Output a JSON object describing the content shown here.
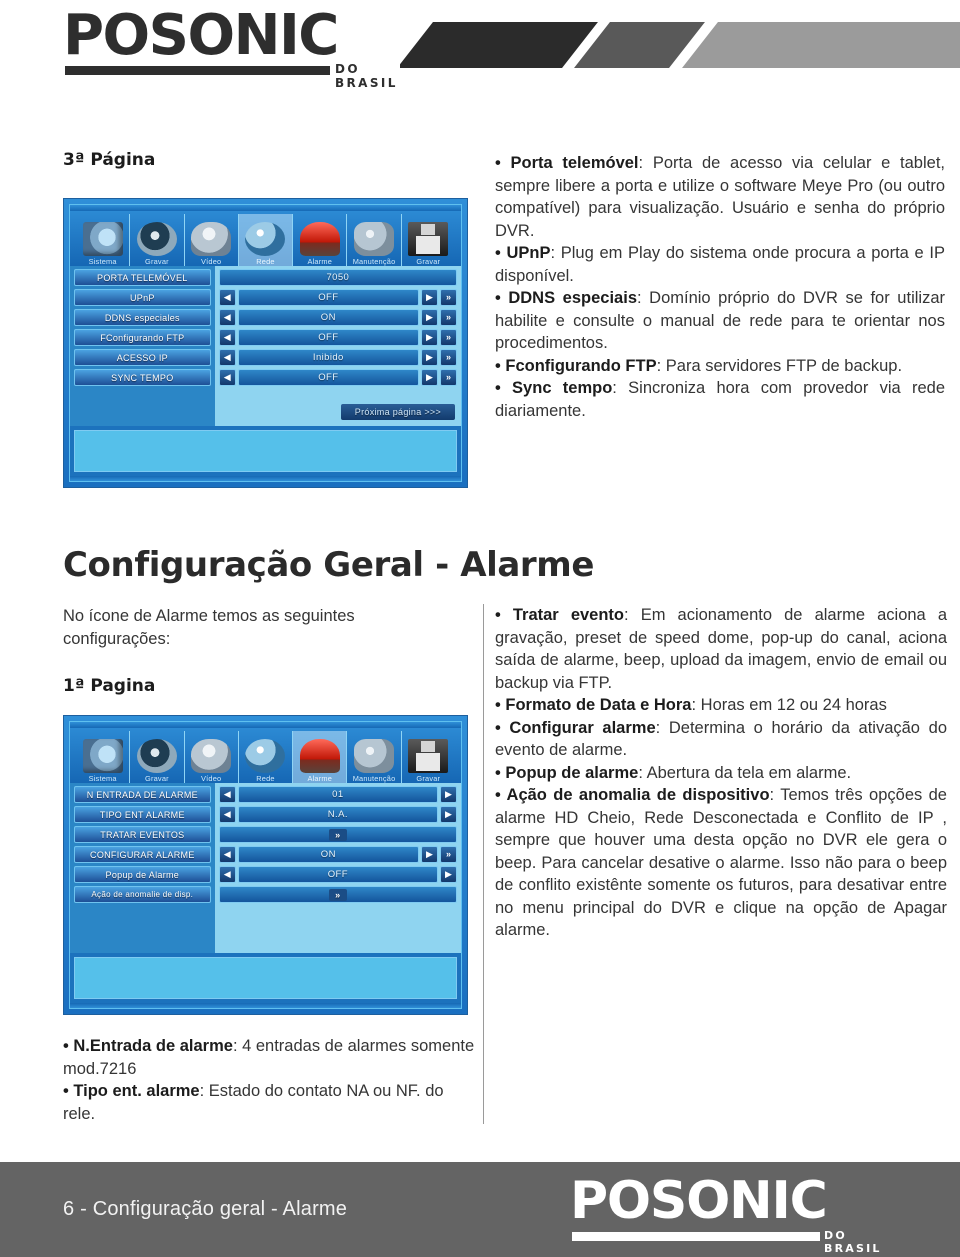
{
  "brand": {
    "name": "POSONIC",
    "tagline": "DO BRASIL"
  },
  "network_section": {
    "page_label": "3ª Página",
    "panel": {
      "tabs": [
        {
          "label": "Sistema",
          "icon": "computer-icon",
          "active": false
        },
        {
          "label": "Gravar",
          "icon": "film-reel-icon",
          "active": false
        },
        {
          "label": "Vídeo",
          "icon": "camera-icon",
          "active": false
        },
        {
          "label": "Rede",
          "icon": "globe-icon",
          "active": true
        },
        {
          "label": "Alarme",
          "icon": "siren-icon",
          "active": false
        },
        {
          "label": "Manutenção",
          "icon": "gears-icon",
          "active": false
        },
        {
          "label": "Gravar",
          "icon": "floppy-disk-icon",
          "active": false
        }
      ],
      "rows": [
        {
          "label": "PORTA TELEMÓVEL",
          "value": "7050",
          "left_arrow": false,
          "right_arrow": false,
          "more": false
        },
        {
          "label": "UPnP",
          "value": "OFF",
          "left_arrow": true,
          "right_arrow": true,
          "more": true
        },
        {
          "label": "DDNS especiales",
          "value": "ON",
          "left_arrow": true,
          "right_arrow": true,
          "more": true
        },
        {
          "label": "FConfigurando FTP",
          "value": "OFF",
          "left_arrow": true,
          "right_arrow": true,
          "more": true
        },
        {
          "label": "ACESSO IP",
          "value": "Inibido",
          "left_arrow": true,
          "right_arrow": true,
          "more": true
        },
        {
          "label": "SYNC TEMPO",
          "value": "OFF",
          "left_arrow": true,
          "right_arrow": true,
          "more": true
        }
      ],
      "next_page_label": "Próxima página >>>"
    },
    "bullets": [
      {
        "term": "• Porta telemóvel",
        "text": ": Porta de acesso via celular e tablet, sempre libere a porta e utilize o software Meye Pro (ou outro compatível) para visualização. Usuário e senha do próprio DVR."
      },
      {
        "term": "• UPnP",
        "text": ": Plug em Play do sistema onde procura a porta e IP disponível."
      },
      {
        "term": "• DDNS especiais",
        "text": ": Domínio próprio do DVR se for utilizar habilite e consulte o manual de rede para te orientar nos procedimentos."
      },
      {
        "term": "• Fconfigurando FTP",
        "text": ": Para servidores FTP de backup."
      },
      {
        "term": "• Sync tempo",
        "text": ": Sincroniza hora com provedor via rede diariamente."
      }
    ]
  },
  "alarm_section": {
    "title": "Configuração Geral - Alarme",
    "intro": "No ícone de Alarme temos as seguintes configurações:",
    "page_label": "1ª Pagina",
    "panel": {
      "tabs": [
        {
          "label": "Sistema",
          "icon": "computer-icon",
          "active": false
        },
        {
          "label": "Gravar",
          "icon": "film-reel-icon",
          "active": false
        },
        {
          "label": "Vídeo",
          "icon": "camera-icon",
          "active": false
        },
        {
          "label": "Rede",
          "icon": "globe-icon",
          "active": false
        },
        {
          "label": "Alarme",
          "icon": "siren-icon",
          "active": true
        },
        {
          "label": "Manutenção",
          "icon": "gears-icon",
          "active": false
        },
        {
          "label": "Gravar",
          "icon": "floppy-disk-icon",
          "active": false
        }
      ],
      "rows": [
        {
          "label": "N ENTRADA DE ALARME",
          "value": "01",
          "left_arrow": true,
          "right_arrow": true,
          "more": false
        },
        {
          "label": "TIPO ENT ALARME",
          "value": "N.A.",
          "left_arrow": true,
          "right_arrow": true,
          "more": false
        },
        {
          "label": "TRATAR EVENTOS",
          "value": ">>",
          "left_arrow": false,
          "right_arrow": false,
          "more": false
        },
        {
          "label": "CONFIGURAR ALARME",
          "value": "ON",
          "left_arrow": true,
          "right_arrow": true,
          "more": true
        },
        {
          "label": "Popup de Alarme",
          "value": "OFF",
          "left_arrow": true,
          "right_arrow": true,
          "more": false
        },
        {
          "label": "Ação de anomalie de disp.",
          "value": ">>",
          "left_arrow": false,
          "right_arrow": false,
          "more": false
        }
      ]
    },
    "left_bullets": [
      {
        "term": "• N.Entrada de alarme",
        "text": ": 4 entradas de alarmes somente mod.7216"
      },
      {
        "term": "• Tipo ent. alarme",
        "text": ": Estado do contato NA ou NF. do rele."
      }
    ],
    "right_bullets": [
      {
        "term": "• Tratar evento",
        "text": ": Em acionamento de alarme aciona a gravação, preset de speed dome, pop-up do canal, aciona saída de alarme, beep, upload da imagem, envio de email ou backup via FTP."
      },
      {
        "term": "• Formato de Data e Hora",
        "text": ": Horas em 12 ou 24 horas"
      },
      {
        "term": "• Configurar alarme",
        "text": ": Determina o horário da ativação do evento de alarme."
      },
      {
        "term": "• Popup de alarme",
        "text": ": Abertura da tela em alarme."
      },
      {
        "term": "• Ação de anomalia de dispositivo",
        "text": ": Temos três opções de alarme HD Cheio, Rede Desconectada e  Conflito de IP , sempre que houver uma desta opção no DVR ele gera o beep. Para cancelar desative o alarme. Isso não para o beep de conflito existênte somente os futuros, para desativar entre no menu principal do DVR e clique na opção de Apagar alarme."
      }
    ]
  },
  "footer": {
    "page_text": "6 - Configuração geral - Alarme"
  }
}
